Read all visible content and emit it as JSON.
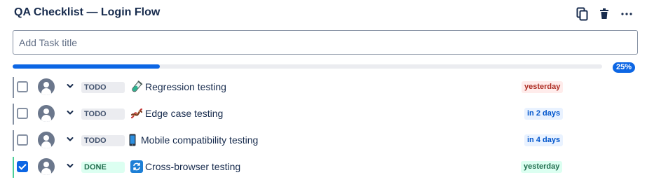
{
  "header": {
    "title": "QA Checklist — Login Flow",
    "icons": [
      "copy-icon",
      "trash-icon",
      "more-icon"
    ]
  },
  "task_input": {
    "placeholder": "Add Task title",
    "value": ""
  },
  "progress": {
    "fraction": 0.25,
    "label": "25%"
  },
  "tasks": [
    {
      "status": "TODO",
      "status_type": "todo",
      "emoji": "test-tube-icon",
      "title": "Regression testing",
      "due": "yesterday",
      "due_color": "red",
      "checked": false
    },
    {
      "status": "TODO",
      "status_type": "todo",
      "emoji": "dna-icon",
      "title": "Edge case testing",
      "due": "in 2 days",
      "due_color": "blue",
      "checked": false
    },
    {
      "status": "TODO",
      "status_type": "todo",
      "emoji": "mobile-phone-icon",
      "title": "Mobile compatibility testing",
      "due": "in 4 days",
      "due_color": "blue",
      "checked": false
    },
    {
      "status": "DONE",
      "status_type": "done",
      "emoji": "refresh-icon",
      "title": "Cross-browser testing",
      "due": "yesterday",
      "due_color": "green",
      "checked": true
    }
  ],
  "colors": {
    "accent": "#0c66e4",
    "due_red_text": "#ae2e24",
    "due_blue_text": "#0055cc",
    "done_green": "#216e4e"
  }
}
